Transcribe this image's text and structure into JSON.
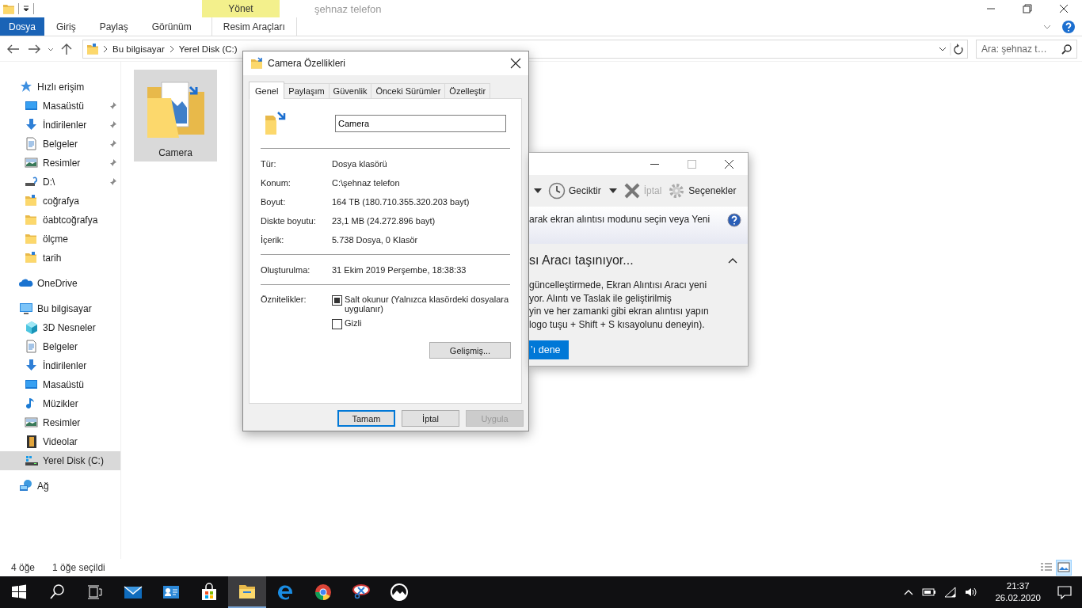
{
  "explorer": {
    "contextual_header": "Yönet",
    "title": "şehnaz telefon",
    "ribbon_tabs": [
      {
        "label": "Dosya",
        "kind": "file",
        "selected": false
      },
      {
        "label": "Giriş",
        "kind": "normal",
        "selected": false
      },
      {
        "label": "Paylaş",
        "kind": "normal",
        "selected": false
      },
      {
        "label": "Görünüm",
        "kind": "normal",
        "selected": false
      },
      {
        "label": "Resim Araçları",
        "kind": "contextual",
        "selected": false
      }
    ],
    "address": {
      "segments": [
        "Bu bilgisayar",
        "Yerel Disk (C:)"
      ]
    },
    "search": {
      "placeholder": "Ara: şehnaz t…"
    },
    "navigation": [
      {
        "label": "Hızlı erişim",
        "kind": "star",
        "selected": false,
        "children": [
          {
            "label": "Masaüstü",
            "kind": "desktop",
            "pinned": true,
            "selected": false
          },
          {
            "label": "İndirilenler",
            "kind": "download",
            "pinned": true,
            "selected": false
          },
          {
            "label": "Belgeler",
            "kind": "document",
            "pinned": true,
            "selected": false
          },
          {
            "label": "Resimler",
            "kind": "pictures",
            "pinned": true,
            "selected": false
          },
          {
            "label": "D:\\",
            "kind": "drive-unknown",
            "pinned": true,
            "selected": false
          },
          {
            "label": "coğrafya",
            "kind": "folder-marked",
            "pinned": false,
            "selected": false
          },
          {
            "label": "öabtcoğrafya",
            "kind": "folder",
            "pinned": false,
            "selected": false
          },
          {
            "label": "ölçme",
            "kind": "folder",
            "pinned": false,
            "selected": false
          },
          {
            "label": "tarih",
            "kind": "folder-marked",
            "pinned": false,
            "selected": false
          }
        ]
      },
      {
        "label": "OneDrive",
        "kind": "cloud",
        "selected": false
      },
      {
        "label": "Bu bilgisayar",
        "kind": "computer",
        "selected": false,
        "children": [
          {
            "label": "3D Nesneler",
            "kind": "cube",
            "selected": false
          },
          {
            "label": "Belgeler",
            "kind": "document",
            "selected": false
          },
          {
            "label": "İndirilenler",
            "kind": "download",
            "selected": false
          },
          {
            "label": "Masaüstü",
            "kind": "desktop",
            "selected": false
          },
          {
            "label": "Müzikler",
            "kind": "music",
            "selected": false
          },
          {
            "label": "Resimler",
            "kind": "pictures",
            "selected": false
          },
          {
            "label": "Videolar",
            "kind": "video",
            "selected": false
          },
          {
            "label": "Yerel Disk (C:)",
            "kind": "drive-windows",
            "selected": true
          }
        ]
      },
      {
        "label": "Ağ",
        "kind": "network",
        "selected": false
      }
    ],
    "items": [
      {
        "name": "Camera",
        "selected": true
      }
    ],
    "status_bar": {
      "count": "4 öğe",
      "selection": "1 öğe seçildi"
    },
    "views": [
      {
        "kind": "details",
        "selected": false
      },
      {
        "kind": "large-icons",
        "selected": true
      }
    ]
  },
  "properties_dialog": {
    "title": "Camera Özellikleri",
    "tabs": [
      {
        "label": "Genel",
        "selected": true
      },
      {
        "label": "Paylaşım",
        "selected": false
      },
      {
        "label": "Güvenlik",
        "selected": false
      },
      {
        "label": "Önceki Sürümler",
        "selected": false
      },
      {
        "label": "Özelleştir",
        "selected": false
      }
    ],
    "name_value": "Camera",
    "groups": [
      [
        {
          "label": "Tür:",
          "value": "Dosya klasörü"
        },
        {
          "label": "Konum:",
          "value": "C:\\şehnaz telefon"
        },
        {
          "label": "Boyut:",
          "value": "164 TB (180.710.355.320.203 bayt)"
        },
        {
          "label": "Diskte boyutu:",
          "value": "23,1 MB (24.272.896 bayt)"
        },
        {
          "label": "İçerik:",
          "value": "5.738 Dosya, 0 Klasör"
        }
      ],
      [
        {
          "label": "Oluşturulma:",
          "value": "31 Ekim 2019 Perşembe, 18:38:33"
        }
      ]
    ],
    "attributes_label": "Öznitelikler:",
    "attributes": [
      {
        "label": "Salt okunur (Yalnızca klasördeki dosyalara uygulanır)",
        "checked": false,
        "indeterminate": true
      },
      {
        "label": "Gizli",
        "checked": false,
        "indeterminate": false
      }
    ],
    "advanced_button": "Gelişmiş...",
    "buttons": [
      {
        "label": "Tamam",
        "default": true,
        "disabled": false
      },
      {
        "label": "İptal",
        "default": false,
        "disabled": false
      },
      {
        "label": "Uygula",
        "default": false,
        "disabled": true
      }
    ]
  },
  "snipping_tool": {
    "toolbar": [
      {
        "kind": "dropdown"
      },
      {
        "kind": "delay",
        "label": "Geciktir",
        "disabled": false
      },
      {
        "kind": "dropdown"
      },
      {
        "kind": "cancel",
        "label": "İptal",
        "disabled": true
      },
      {
        "kind": "options",
        "label": "Seçenekler",
        "disabled": false
      }
    ],
    "hint": "arak ekran alıntısı modunu seçin veya Yeni",
    "heading": "sı Aracı taşınıyor...",
    "lines": [
      "güncelleştirmede, Ekran Alıntısı Aracı yeni",
      "yor. Alıntı ve Taslak ile geliştirilmiş",
      "yin ve her zamanki gibi ekran alıntısı yapın",
      "logo tuşu + Shift + S kısayolunu deneyin)."
    ],
    "button": "’ı dene"
  },
  "taskbar": {
    "apps": [
      {
        "kind": "mail",
        "active": false
      },
      {
        "kind": "contacts",
        "active": false
      },
      {
        "kind": "store",
        "active": false
      },
      {
        "kind": "explorer",
        "active": true
      },
      {
        "kind": "edge",
        "active": false
      },
      {
        "kind": "chrome",
        "active": false
      },
      {
        "kind": "snip",
        "active": false
      },
      {
        "kind": "photos",
        "active": false
      }
    ],
    "time": "21:37",
    "date": "26.02.2020"
  }
}
